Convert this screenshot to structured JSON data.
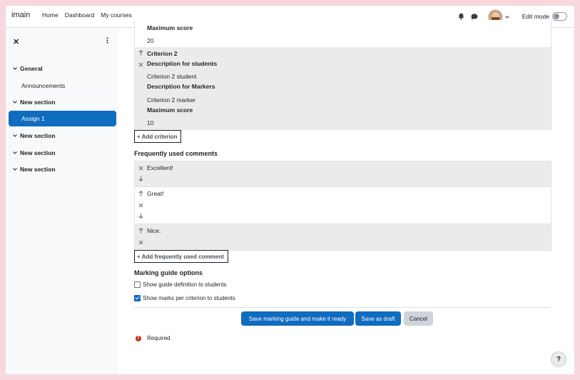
{
  "navbar": {
    "brand": "imain",
    "links": [
      "Home",
      "Dashboard",
      "My courses"
    ],
    "edit_mode_label": "Edit mode"
  },
  "drawer": {
    "items": [
      {
        "label": "General",
        "type": "section"
      },
      {
        "label": "Announcements",
        "type": "sub"
      },
      {
        "label": "New section",
        "type": "section"
      },
      {
        "label": "Assign 1",
        "type": "active"
      },
      {
        "label": "New section",
        "type": "section"
      },
      {
        "label": "New section",
        "type": "section"
      },
      {
        "label": "New section",
        "type": "section"
      }
    ]
  },
  "criteria": {
    "crit1_partial": {
      "max_score_label": "Maximum score",
      "max_score": "20"
    },
    "crit2": {
      "name": "Criterion 2",
      "students_heading": "Description for students",
      "students_text": "Criterion 2 student",
      "markers_heading": "Description for Markers",
      "markers_text": "Criterion 2 marker",
      "max_score_label": "Maximum score",
      "max_score": "10"
    },
    "add_label": "Add criterion"
  },
  "comments": {
    "heading": "Frequently used comments",
    "items": [
      "Excellent!",
      "Great!",
      "Nice."
    ],
    "add_label": "Add frequently used comment"
  },
  "options": {
    "heading": "Marking guide options",
    "show_definition": {
      "label": "Show guide definition to students",
      "checked": false
    },
    "show_marks": {
      "label": "Show marks per criterion to students",
      "checked": true
    }
  },
  "actions": {
    "save_ready": "Save marking guide and make it ready",
    "save_draft": "Save as draft",
    "cancel": "Cancel"
  },
  "required_label": "Required",
  "help_label": "?",
  "colors": {
    "primary": "#0f6cbf",
    "row_shade": "#ebebeb",
    "required": "#ca3120",
    "page_bg": "#f8d7dd"
  }
}
